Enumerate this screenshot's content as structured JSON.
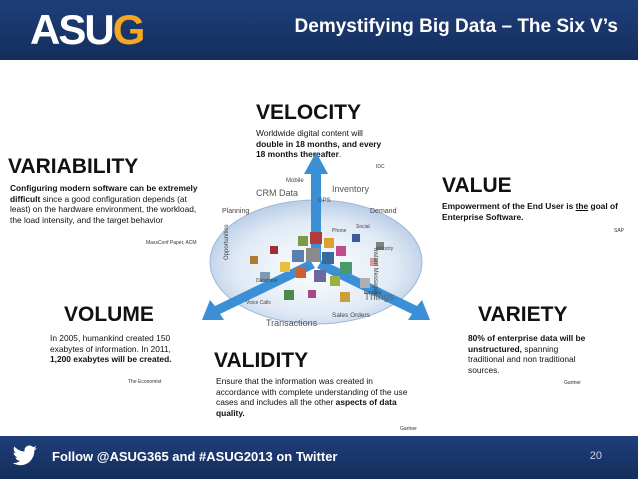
{
  "header": {
    "logo_main": "ASU",
    "logo_accent": "G",
    "title": "Demystifying Big Data – The Six V’s"
  },
  "sections": {
    "velocity": {
      "title": "VELOCITY",
      "body_plain1": "Worldwide digital content will",
      "body_bold": "double in 18 months, and every 18 months thereafter",
      "body_end": ".",
      "source": "IDC"
    },
    "variability": {
      "title": "VARIABILITY",
      "body_bold": "Configuring modern software can be extremely difficult",
      "body_plain": " since a good configuration depends (at least) on the hardware environment, the workload, the load intensity, and the target behavior",
      "source": "MassConf Paper, ACM"
    },
    "value": {
      "title": "VALUE",
      "body_pre": "Empowerment of the End User is ",
      "body_u": "the",
      "body_post": " goal of Enterprise Software.",
      "source": "SAP"
    },
    "volume": {
      "title": "VOLUME",
      "body_plain1": "In 2005, humankind created 150 exabytes of information. In 2011, ",
      "body_bold": "1,200 exabytes will be created.",
      "source": "The Economist"
    },
    "validity": {
      "title": "VALIDITY",
      "body_plain1": "Ensure that the information was created in accordance with complete understanding of the use cases and includes all the other ",
      "body_bold": "aspects of data quality.",
      "source": "Gartner"
    },
    "variety": {
      "title": "VARIETY",
      "body_bold": "80% of enterprise data will be unstructured,",
      "body_plain": " spanning traditional and non traditional sources.",
      "source": "Gartner"
    }
  },
  "graphic": {
    "labels": [
      "Mobile",
      "CRM Data",
      "Inventory",
      "GPS",
      "Planning",
      "Demand",
      "Instant Messages",
      "Opportunities",
      "Things",
      "Transactions",
      "Sales Orders",
      "Velocity",
      "Phone",
      "Voice Calls",
      "Database",
      "Social",
      "Erpdata"
    ]
  },
  "footer": {
    "text": "Follow @ASUG365 and #ASUG2013 on Twitter",
    "page": "20"
  },
  "colors": {
    "header_bg": "#1f3f7a",
    "accent": "#f5a623",
    "arrow": "#3a8fd6"
  }
}
